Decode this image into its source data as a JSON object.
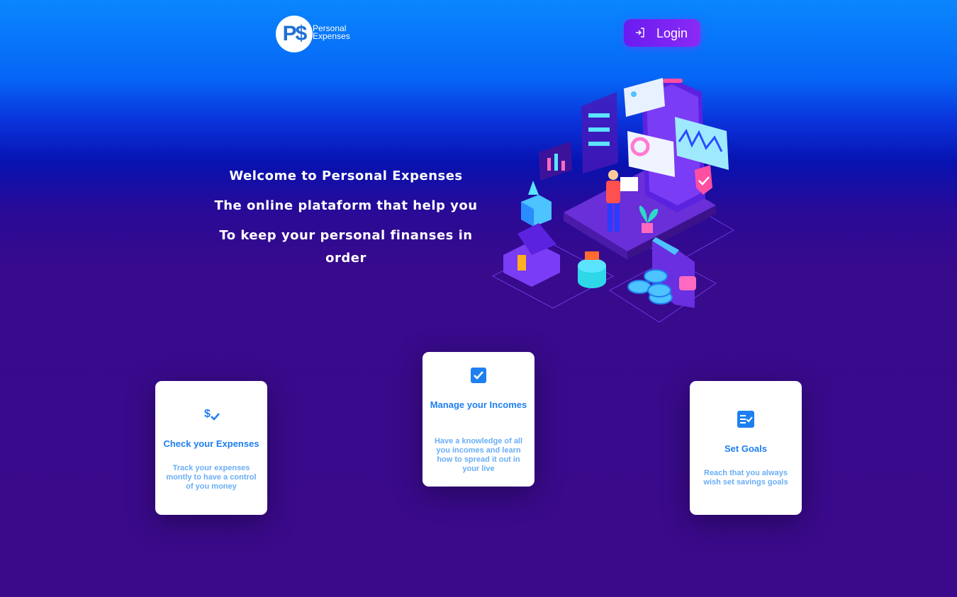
{
  "logo": {
    "mark": "P$",
    "line1": "Personal",
    "line2": "Expenses"
  },
  "login": {
    "label": "Login",
    "icon": "login-icon"
  },
  "hero": {
    "line1": "Welcome to Personal Expenses",
    "line2": "The online plataform that help you",
    "line3": "To keep your personal finanses in order"
  },
  "cards": [
    {
      "icon": "dollar-check-icon",
      "title": "Check your Expenses",
      "description": "Track your expenses montly to have a control of you money"
    },
    {
      "icon": "checkbox-icon",
      "title": "Manage your Incomes",
      "description": "Have a knowledge of all you incomes and learn how to spread it out in your live"
    },
    {
      "icon": "checklist-icon",
      "title": "Set Goals",
      "description": "Reach that you always wish set savings goals"
    }
  ],
  "colors": {
    "accent": "#1e7ff0",
    "button": "#7a24f2",
    "background_top": "#0a86fd",
    "background_bottom": "#3a0a8a"
  }
}
